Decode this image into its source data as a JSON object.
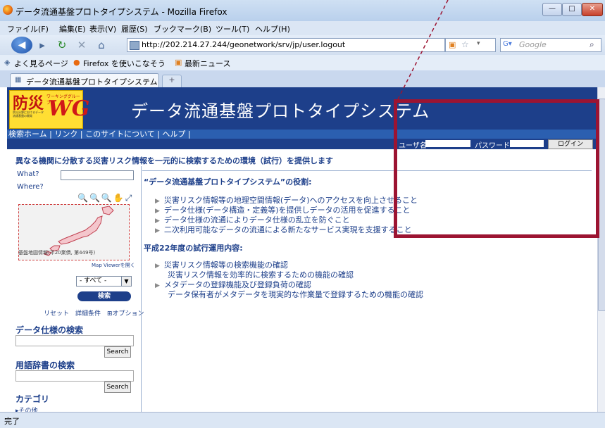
{
  "window": {
    "title": "データ流通基盤プロトタイプシステム - Mozilla Firefox",
    "controls": [
      "—",
      "□",
      "✕"
    ]
  },
  "menu": [
    "ファイル(F)",
    "編集(E)",
    "表示(V)",
    "履歴(S)",
    "ブックマーク(B)",
    "ツール(T)",
    "ヘルプ(H)"
  ],
  "navbar": {
    "url": "http://202.214.27.244/geonetwork/srv/jp/user.logout",
    "search_placeholder": "Google"
  },
  "bookmarks": [
    "よく見るページ",
    "Firefox を使いこなそう",
    "最新ニュース"
  ],
  "tab": {
    "title": "データ流通基盤プロトタイプシステム",
    "new_tab": "+"
  },
  "header": {
    "logo_main": "防災",
    "logo_wg": "WG",
    "logo_small": "ワーキンググループ",
    "logo_sub": "防災分野におけるデータ流通基盤の開発",
    "title": "データ流通基盤プロトタイプシステム"
  },
  "nav_links": "検索ホーム | リンク | このサイトについて | ヘルプ |",
  "login": {
    "user_label": "ユーザ名",
    "password_label": "パスワード",
    "button": "ログイン"
  },
  "tagline": "異なる機関に分散する災害リスク情報を一元的に検索するための環境（試行）を提供します",
  "sidebar": {
    "what_label": "What?",
    "where_label": "Where?",
    "map_tools": "🔍🔍🔍✋⤢",
    "map_caption": "基盤地図情報(平20業債, 第449号)",
    "map_link": "Map Viewerを開く",
    "select_value": "- すべて -",
    "search_button": "検索",
    "links": "リセット　詳細条件　⊞オプション",
    "spec_heading": "データ仕様の検索",
    "spec_button": "Search",
    "dict_heading": "用語辞書の検索",
    "dict_button": "Search",
    "category_heading": "カテゴリ",
    "category_item": "▸その他"
  },
  "main": {
    "section1_title": "“データ流通基盤プロトタイプシステム”の役割:",
    "section1_items": [
      "災害リスク情報等の地理空間情報(データ)へのアクセスを向上させること",
      "データ仕様(データ構造・定義等)を提供しデータの活用を促進すること",
      "データ仕様の流通によりデータ仕様の乱立を防ぐこと",
      "二次利用可能なデータの流通による新たなサービス実現を支援すること"
    ],
    "section2_title": "平成22年度の試行運用内容:",
    "section2_items": [
      {
        "label": "災害リスク情報等の検索機能の確認",
        "sub": "災害リスク情報を効率的に検索するための機能の確認"
      },
      {
        "label": "メタデータの登録機能及び登録負荷の確認",
        "sub": "データ保有者がメタデータを現実的な作業量で登録するための機能の確認"
      }
    ]
  },
  "status": "完了",
  "colors": {
    "highlight": "#9c1432",
    "header_bg": "#1d3f8a",
    "text_blue": "#1d3f8a"
  }
}
